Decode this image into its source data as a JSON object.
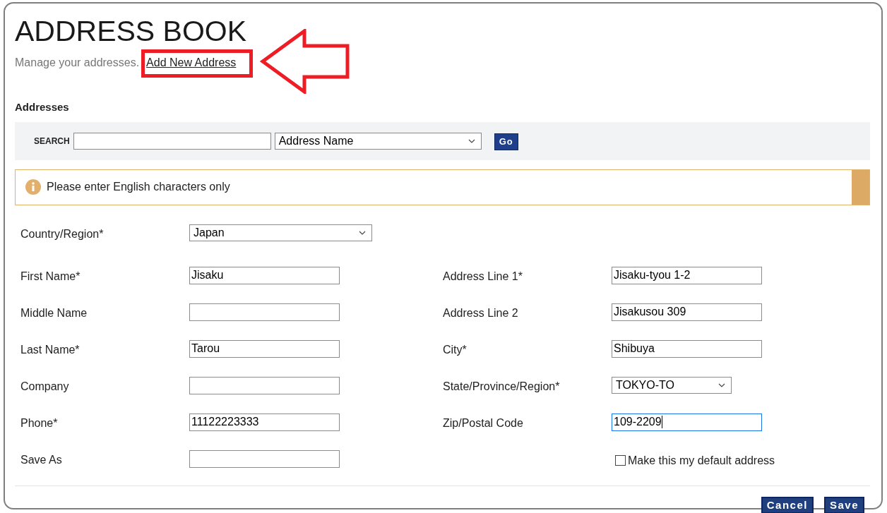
{
  "header": {
    "title": "ADDRESS BOOK",
    "subtitle": "Manage your addresses.",
    "link": "Add New Address"
  },
  "section_title": "Addresses",
  "search": {
    "label": "SEARCH",
    "filter": "Address Name",
    "button": "Go"
  },
  "notice": "Please enter English characters only",
  "country": {
    "label": "Country/Region*",
    "value": "Japan"
  },
  "left_fields": [
    {
      "label": "First Name*",
      "value": "Jisaku",
      "kind": "text",
      "focused": false
    },
    {
      "label": "Middle Name",
      "kind": "text",
      "focused": false
    },
    {
      "label": "Last Name*",
      "value": "Tarou",
      "kind": "text",
      "focused": false
    },
    {
      "label": "Company",
      "kind": "text",
      "focused": false
    },
    {
      "label": "Phone*",
      "value": "11122223333",
      "kind": "text",
      "focused": false
    },
    {
      "label": "Save As",
      "kind": "text",
      "focused": false
    }
  ],
  "right_fields": [
    {
      "label": "Address Line 1*",
      "value": "Jisaku-tyou 1-2",
      "kind": "text",
      "focused": false
    },
    {
      "label": "Address Line 2",
      "value": "Jisakusou 309",
      "kind": "text",
      "focused": false
    },
    {
      "label": "City*",
      "value": "Shibuya",
      "kind": "text",
      "focused": false
    },
    {
      "label": "State/Province/Region*",
      "value": "TOKYO-TO",
      "kind": "select",
      "focused": false
    },
    {
      "label": "Zip/Postal Code",
      "value": "109-2209",
      "kind": "text",
      "focused": true
    }
  ],
  "default_checkbox": {
    "label": "Make this my default address",
    "checked": false
  },
  "buttons": [
    {
      "label": "Cancel"
    },
    {
      "label": "Save"
    }
  ]
}
